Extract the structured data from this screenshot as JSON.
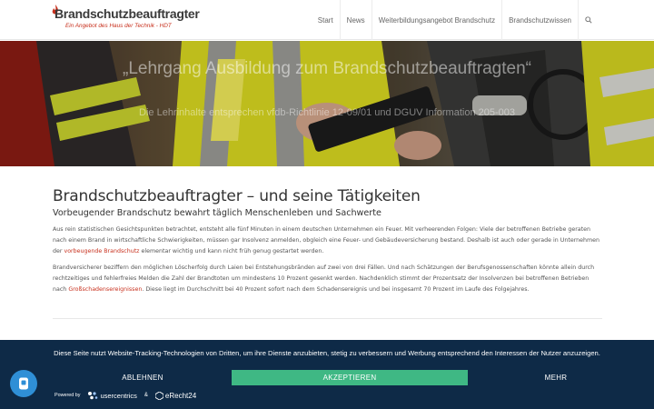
{
  "header": {
    "logo_title": "Brandschutzbeauftragter",
    "logo_subtitle": "Ein Angebot des Haus der Technik - HDT",
    "nav": [
      "Start",
      "News",
      "Weiterbildungsangebot Brandschutz",
      "Brandschutzwissen"
    ],
    "search_icon": "search-icon"
  },
  "hero": {
    "heading": "„Lehrgang Ausbildung zum Brandschutzbeauftragten“",
    "text": "Die Lehrinhalte entsprechen vfdb-Richtlinie 12-09/01 und DGUV Information 205-003"
  },
  "main": {
    "title": "Brandschutzbeauftragter – und seine Tätigkeiten",
    "subtitle": "Vorbeugender Brandschutz bewahrt täglich Menschenleben und Sachwerte",
    "para1_a": "Aus rein statistischen Gesichtspunkten betrachtet, entsteht alle fünf Minuten in einem deutschen Unternehmen ein Feuer. Mit verheerenden Folgen: Viele der betroffenen Betriebe geraten nach einem Brand in wirtschaftliche Schwierigkeiten, müssen gar Insolvenz anmelden, obgleich eine Feuer- und Gebäudeversicherung bestand. Deshalb ist auch oder gerade in Unternehmen der ",
    "para1_link": "vorbeugende Brandschutz",
    "para1_b": " elementar wichtig und kann nicht früh genug gestartet werden.",
    "para2_a": "Brandversicherer beziffern den möglichen Löscherfolg durch Laien bei Entstehungsbränden auf zwei von drei Fällen. Und nach Schätzungen der Berufsgenossenschaften könnte allein durch rechtzeitiges und fehlerfreies Melden die Zahl der Brandtoten um mindestens 10 Prozent gesenkt werden. Nachdenklich stimmt der Prozentsatz der Insolvenzen bei betroffenen Betrieben nach ",
    "para2_link": "Großschadensereignissen",
    "para2_b": ". Diese liegt im Durchschnitt bei 40 Prozent sofort nach dem Schadensereignis und bei insgesamt 70 Prozent im Laufe des Folgejahres."
  },
  "cookie": {
    "text": "Diese Seite nutzt Website-Tracking-Technologien von Dritten, um ihre Dienste anzubieten, stetig zu verbessern und Werbung entsprechend den Interessen der Nutzer anzuzeigen.",
    "reject": "ABLEHNEN",
    "accept": "AKZEPTIEREN",
    "more": "MEHR",
    "powered_by": "Powered by",
    "usercentrics": "usercentrics",
    "amp": "&",
    "erecht": "eRecht24"
  },
  "colors": {
    "brand_red": "#c8311e",
    "banner_bg": "#0e2a47",
    "accept_green": "#3fb884",
    "fab_blue": "#2f8fd6"
  }
}
